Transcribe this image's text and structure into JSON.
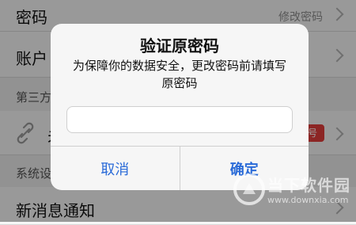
{
  "settings": {
    "password_row": {
      "label": "密码",
      "value": "修改密码"
    },
    "account_row": {
      "label": "账户"
    },
    "third_party_section": {
      "title": "第三方"
    },
    "linked_row": {
      "label": "未",
      "badge": "号"
    },
    "system_section": {
      "title": "系统设"
    },
    "notification_row": {
      "label": "新消息通知"
    }
  },
  "dialog": {
    "title": "验证原密码",
    "message": "为保障你的数据安全，更改密码前请填写原密码",
    "input_value": "",
    "cancel_label": "取消",
    "confirm_label": "确定"
  },
  "watermark": {
    "name": "当下软件园",
    "url": "www.downxia.com"
  },
  "colors": {
    "accent": "#2a6bd8",
    "badge": "#e23c3a",
    "overlay": "rgba(0,0,0,0.38)"
  }
}
